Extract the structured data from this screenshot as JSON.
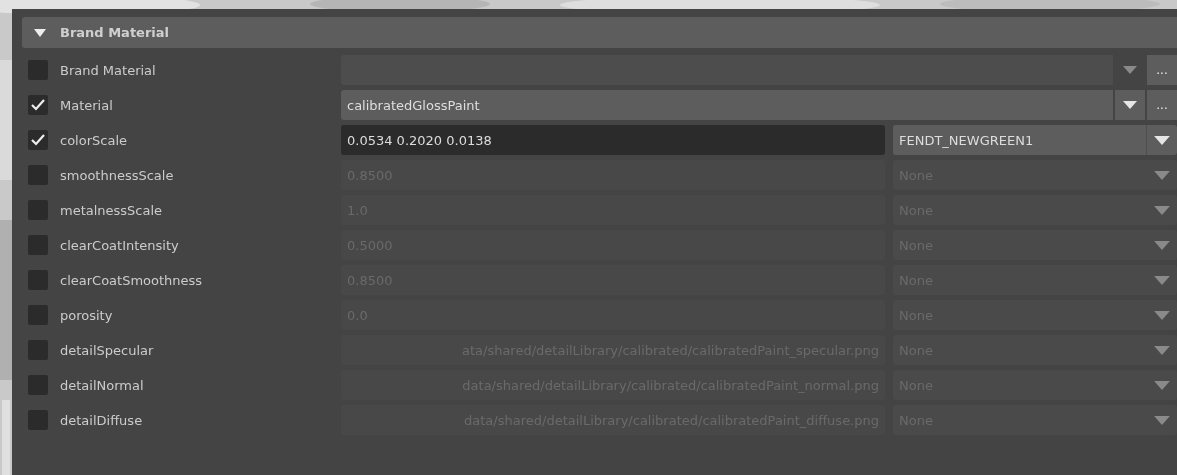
{
  "section": {
    "title": "Brand Material",
    "expanded": true
  },
  "rows": [
    {
      "kind": "combo",
      "label": "Brand Material",
      "checked": false,
      "value": "",
      "browse": "..."
    },
    {
      "kind": "combo",
      "label": "Material",
      "checked": true,
      "value": "calibratedGlossPaint",
      "browse": "..."
    },
    {
      "kind": "value",
      "label": "colorScale",
      "checked": true,
      "value": "0.0534 0.2020 0.0138",
      "preset": "FENDT_NEWGREEN1"
    },
    {
      "kind": "value",
      "label": "smoothnessScale",
      "checked": false,
      "value": "0.8500",
      "preset": "None"
    },
    {
      "kind": "value",
      "label": "metalnessScale",
      "checked": false,
      "value": "1.0",
      "preset": "None"
    },
    {
      "kind": "value",
      "label": "clearCoatIntensity",
      "checked": false,
      "value": "0.5000",
      "preset": "None"
    },
    {
      "kind": "value",
      "label": "clearCoatSmoothness",
      "checked": false,
      "value": "0.8500",
      "preset": "None"
    },
    {
      "kind": "value",
      "label": "porosity",
      "checked": false,
      "value": "0.0",
      "preset": "None"
    },
    {
      "kind": "value",
      "label": "detailSpecular",
      "checked": false,
      "value": "ata/shared/detailLibrary/calibrated/calibratedPaint_specular.png",
      "preset": "None"
    },
    {
      "kind": "value",
      "label": "detailNormal",
      "checked": false,
      "value": "data/shared/detailLibrary/calibrated/calibratedPaint_normal.png",
      "preset": "None"
    },
    {
      "kind": "value",
      "label": "detailDiffuse",
      "checked": false,
      "value": "data/shared/detailLibrary/calibrated/calibratedPaint_diffuse.png",
      "preset": "None"
    }
  ]
}
